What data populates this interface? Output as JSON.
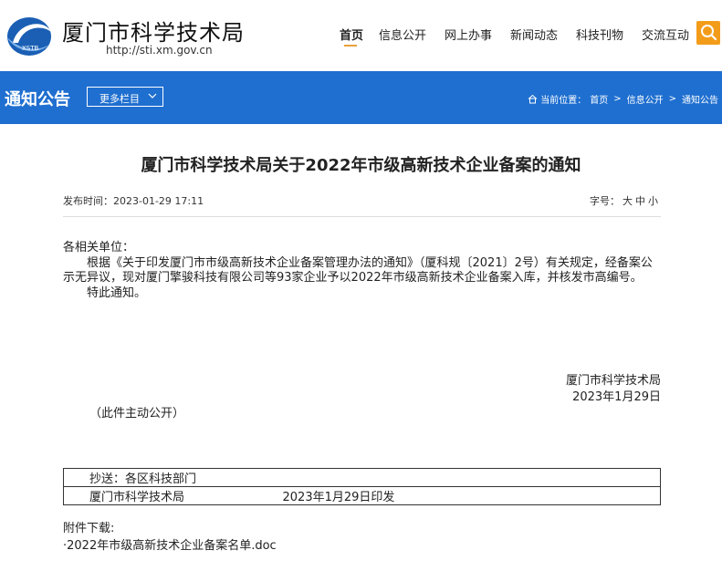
{
  "header": {
    "site_name": "厦门市科学技术局",
    "site_url": "http://sti.xm.gov.cn",
    "logo_text": "XSTB",
    "nav": [
      {
        "label": "首页",
        "active": true
      },
      {
        "label": "信息公开"
      },
      {
        "label": "网上办事"
      },
      {
        "label": "新闻动态"
      },
      {
        "label": "科技刊物"
      },
      {
        "label": "交流互动"
      }
    ],
    "accent": "#f39c1a",
    "brand_blue": "#1f6fd0"
  },
  "banner": {
    "title": "通知公告",
    "more_label": "更多栏目",
    "crumbs_prefix": "当前位置：",
    "crumbs": [
      "首页",
      "信息公开",
      "通知公告"
    ]
  },
  "article": {
    "title": "厦门市科学技术局关于2022年市级高新技术企业备案的通知",
    "publish_time": "发布时间：2023-01-29 17:11",
    "font_size_label": "字号：",
    "font_sizes": [
      "大",
      "中",
      "小"
    ],
    "salutation": "各相关单位：",
    "paragraph1": "根据《关于印发厦门市市级高新技术企业备案管理办法的通知》（厦科规〔2021〕2号）有关规定，经备案公示无异议，现对厦门擎骏科技有限公司等93家企业予以2022年市级高新技术企业备案入库，并核发市高编号。",
    "paragraph2": "特此通知。",
    "signature_org": "厦门市科学技术局",
    "signature_date": "2023年1月29日",
    "public_note": "（此件主动公开）",
    "cc_line": "抄送：各区科技部门",
    "issuer": "厦门市科学技术局",
    "issue_date": "2023年1月29日印发",
    "attachment_label": "附件下载:",
    "attachment_file": "·2022年市级高新技术企业备案名单.doc"
  }
}
